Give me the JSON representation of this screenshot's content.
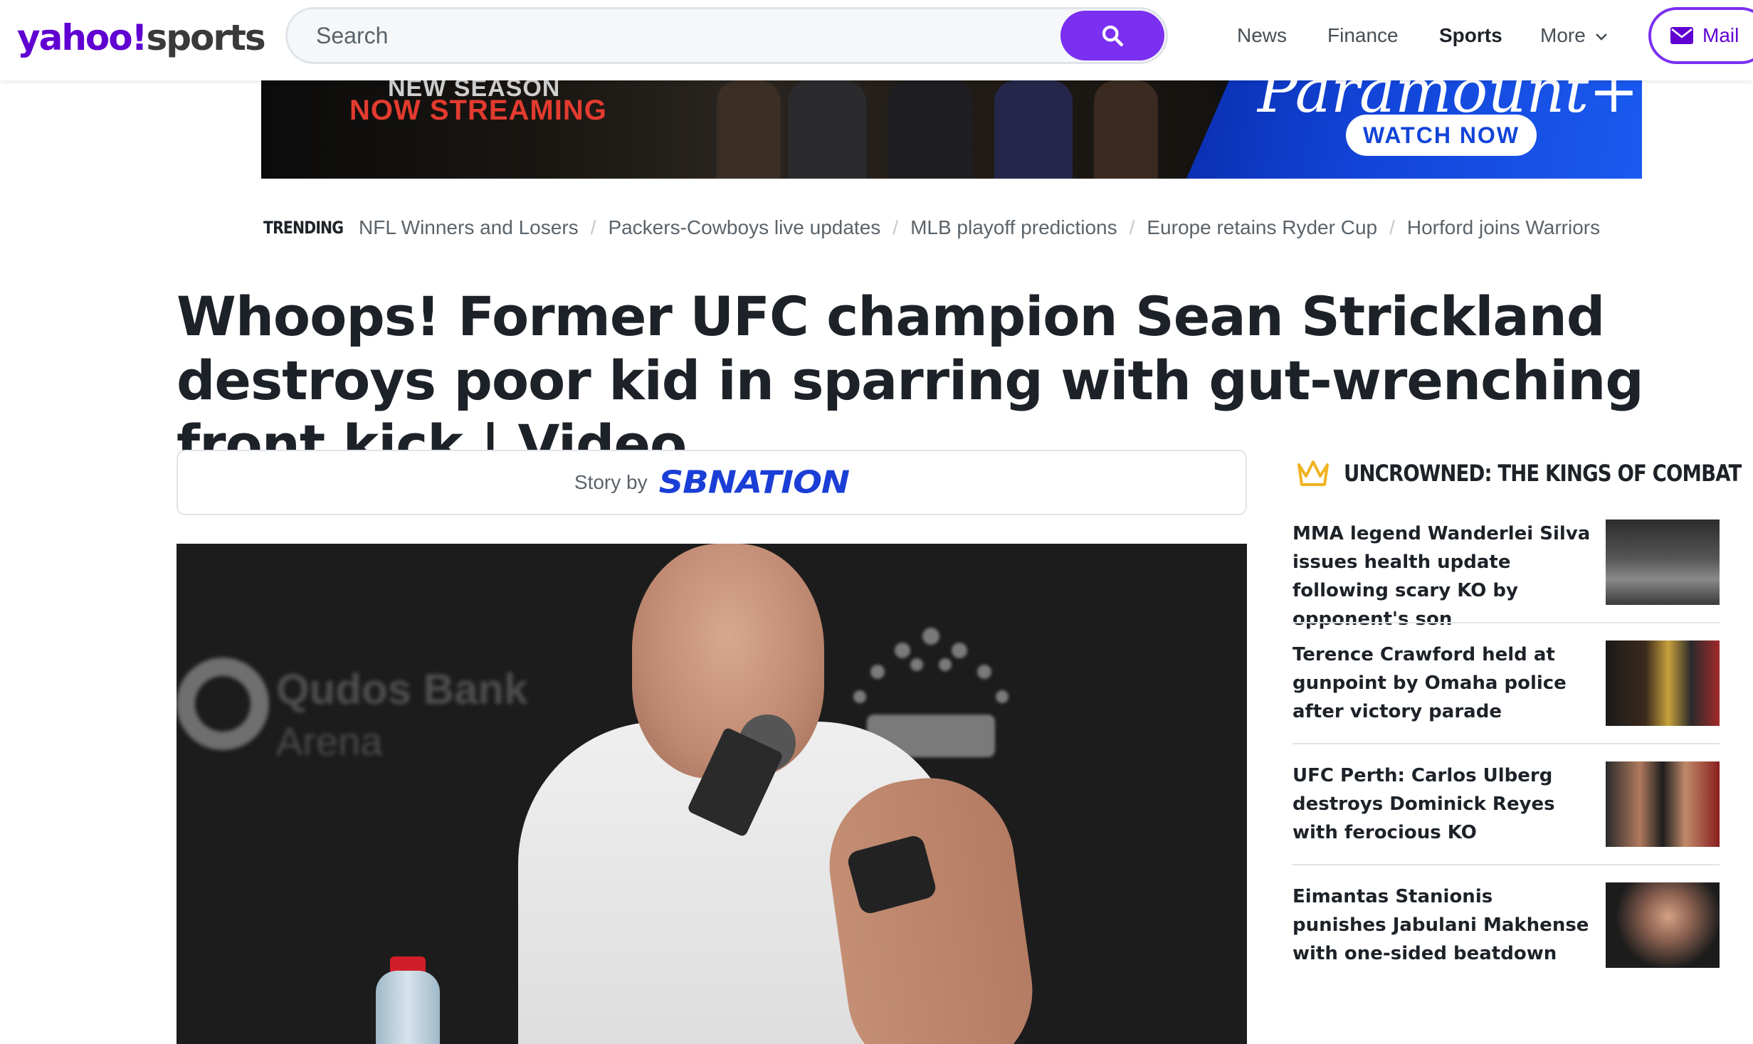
{
  "header": {
    "logo_yahoo": "yahoo!",
    "logo_sports": "sports",
    "search_placeholder": "Search",
    "nav": [
      {
        "label": "News"
      },
      {
        "label": "Finance"
      },
      {
        "label": "Sports",
        "active": true
      },
      {
        "label": "More"
      }
    ],
    "mail_label": "Mail"
  },
  "ad": {
    "line1": "NEW SEASON",
    "line2": "NOW STREAMING",
    "brand": "Paramount+",
    "cta": "WATCH NOW"
  },
  "trending": {
    "label": "TRENDING",
    "links": [
      "NFL Winners and Losers",
      "Packers-Cowboys live updates",
      "MLB playoff predictions",
      "Europe retains Ryder Cup",
      "Horford joins Warriors"
    ]
  },
  "article": {
    "headline": "Whoops! Former UFC champion Sean Strickland destroys poor kid in sparring with gut-wrenching front kick | Video",
    "story_by_label": "Story by",
    "source": "SBNATION",
    "hero_venue_line1": "Qudos Bank",
    "hero_venue_line2": "Arena"
  },
  "sidebar": {
    "title": "UNCROWNED: THE KINGS OF COMBAT",
    "items": [
      {
        "title": "MMA legend Wanderlei Silva issues health update following scary KO by opponent's son"
      },
      {
        "title": "Terence Crawford held at gunpoint by Omaha police after victory parade"
      },
      {
        "title": "UFC Perth: Carlos Ulberg destroys Dominick Reyes with ferocious KO"
      },
      {
        "title": "Eimantas Stanionis punishes Jabulani Makhense with one-sided beatdown"
      }
    ]
  },
  "colors": {
    "brand_purple": "#6001d2",
    "search_button": "#7b2ff0",
    "sbnation_blue": "#1a3ed6",
    "crown_gold": "#f0b323"
  },
  "icons": {
    "search": "search-icon",
    "more": "chevron-down-icon",
    "mail": "mail-icon",
    "sidebar": "crown-icon"
  }
}
